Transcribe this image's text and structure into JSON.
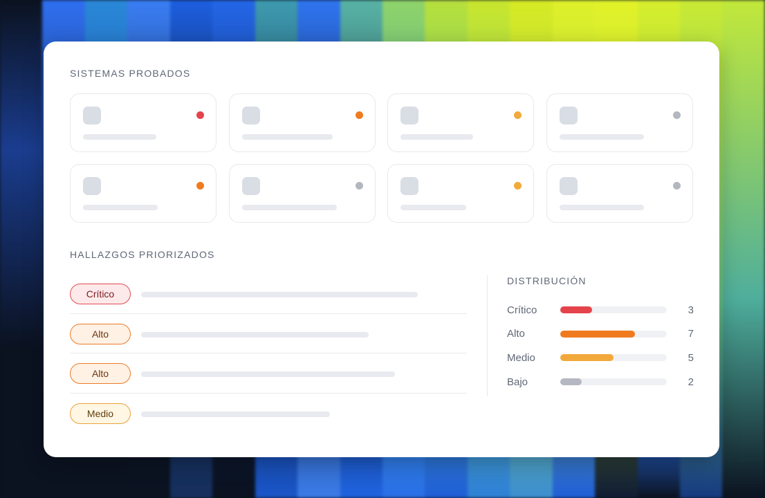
{
  "colors": {
    "critico": "#e5434b",
    "alto": "#f07b1f",
    "medio": "#f2a93b",
    "bajo": "#b5b8c2",
    "gris": "#b3b7bf"
  },
  "systems": {
    "title": "SISTEMAS PROBADOS",
    "tiles": [
      {
        "status": "critico",
        "dot_color": "#e5434b",
        "line_fraction": 0.56
      },
      {
        "status": "alto",
        "dot_color": "#f07b1f",
        "line_fraction": 0.69
      },
      {
        "status": "medio",
        "dot_color": "#f2a93b",
        "line_fraction": 0.55
      },
      {
        "status": "gris",
        "dot_color": "#b3b7bf",
        "line_fraction": 0.64
      },
      {
        "status": "alto",
        "dot_color": "#f07b1f",
        "line_fraction": 0.57
      },
      {
        "status": "gris",
        "dot_color": "#b3b7bf",
        "line_fraction": 0.72
      },
      {
        "status": "medio",
        "dot_color": "#f2a93b",
        "line_fraction": 0.5
      },
      {
        "status": "gris",
        "dot_color": "#b3b7bf",
        "line_fraction": 0.64
      }
    ]
  },
  "findings": {
    "title": "HALLAZGOS PRIORIZADOS",
    "items": [
      {
        "label": "Crítico",
        "level": "critico",
        "line_fraction": 0.85
      },
      {
        "label": "Alto",
        "level": "alto",
        "line_fraction": 0.7
      },
      {
        "label": "Alto",
        "level": "alto",
        "line_fraction": 0.78
      },
      {
        "label": "Medio",
        "level": "medio",
        "line_fraction": 0.58
      }
    ]
  },
  "distribution": {
    "title": "DISTRIBUCIÓN",
    "max": 10,
    "rows": [
      {
        "label": "Crítico",
        "count": 3,
        "color": "#e5434b"
      },
      {
        "label": "Alto",
        "count": 7,
        "color": "#f07b1f"
      },
      {
        "label": "Medio",
        "count": 5,
        "color": "#f2a93b"
      },
      {
        "label": "Bajo",
        "count": 2,
        "color": "#b5b8c2"
      }
    ]
  }
}
